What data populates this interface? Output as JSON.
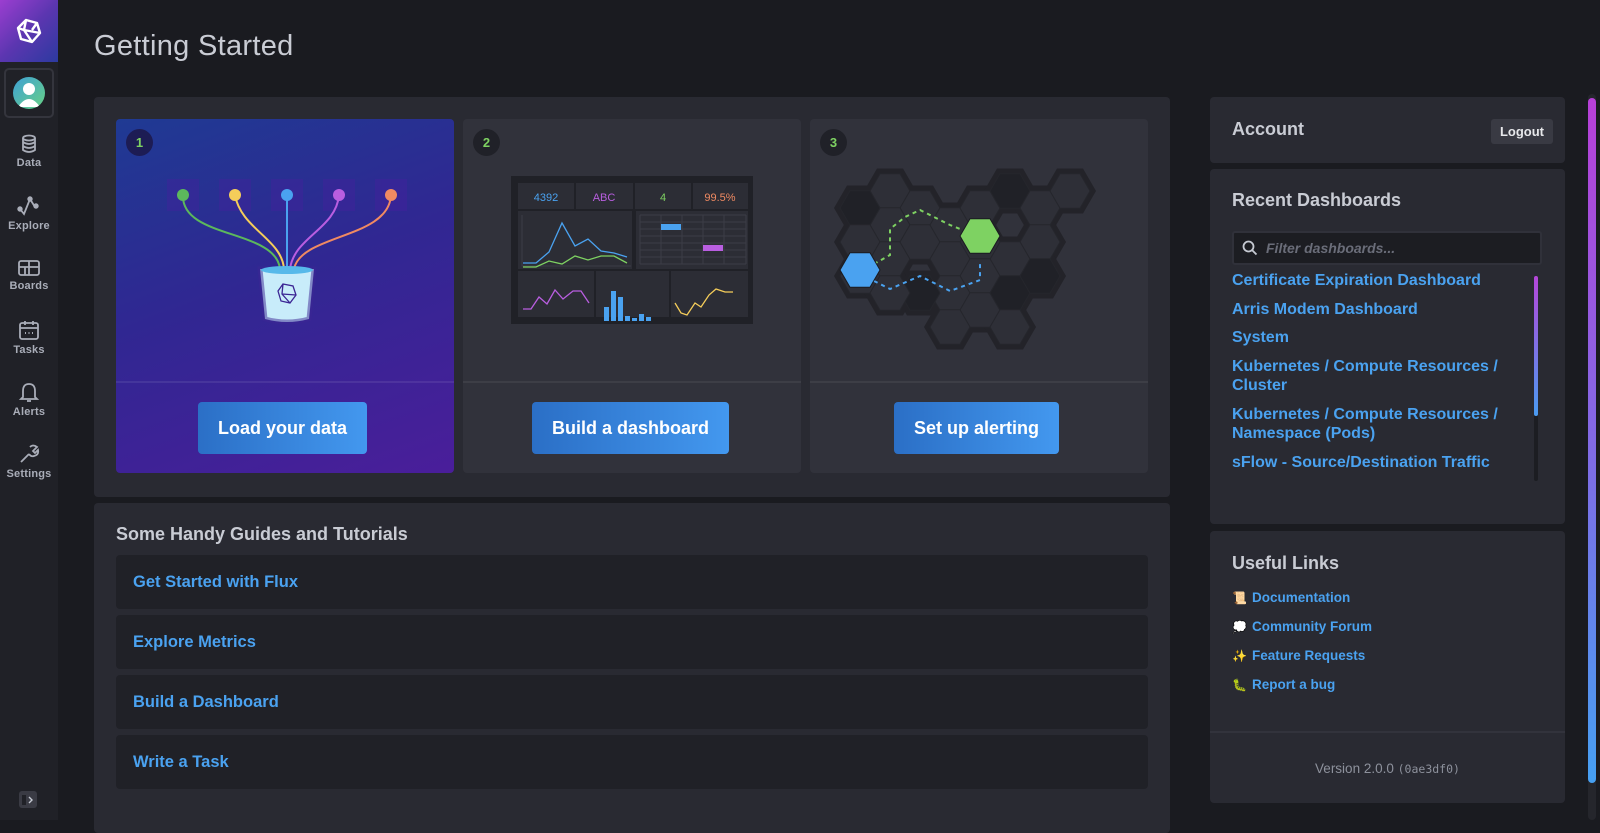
{
  "sidebar": {
    "logo": "influxdb-logo-icon",
    "avatar": "user-avatar-icon",
    "items": [
      {
        "label": "Data",
        "icon": "database-icon"
      },
      {
        "label": "Explore",
        "icon": "graph-line-icon"
      },
      {
        "label": "Boards",
        "icon": "dashboard-grid-icon"
      },
      {
        "label": "Tasks",
        "icon": "calendar-icon"
      },
      {
        "label": "Alerts",
        "icon": "bell-icon"
      },
      {
        "label": "Settings",
        "icon": "wrench-icon"
      }
    ],
    "collapse_icon": "expand-sidebar-icon"
  },
  "page": {
    "title": "Getting Started"
  },
  "steps": [
    {
      "number": "1",
      "button": "Load your data",
      "illustration": "data-sources-bucket"
    },
    {
      "number": "2",
      "button": "Build a dashboard",
      "illustration": "dashboard-preview",
      "preview_stats": [
        {
          "value": "4392",
          "color": "#4aa2f0"
        },
        {
          "value": "ABC",
          "color": "#b95ee0"
        },
        {
          "value": "4",
          "color": "#7ed262"
        },
        {
          "value": "99.5%",
          "color": "#f08a62"
        }
      ]
    },
    {
      "number": "3",
      "button": "Set up alerting",
      "illustration": "hexagon-network"
    }
  ],
  "guides": {
    "title": "Some Handy Guides and Tutorials",
    "items": [
      "Get Started with Flux",
      "Explore Metrics",
      "Build a Dashboard",
      "Write a Task"
    ]
  },
  "account": {
    "title": "Account",
    "logout": "Logout"
  },
  "recent_dashboards": {
    "title": "Recent Dashboards",
    "filter_placeholder": "Filter dashboards...",
    "filter_value": "",
    "search_icon": "search-icon",
    "items": [
      "Certificate Expiration Dashboard",
      "Arris Modem Dashboard",
      "System",
      "Kubernetes / Compute Resources / Cluster",
      "Kubernetes / Compute Resources / Namespace (Pods)",
      "sFlow - Source/Destination Traffic"
    ]
  },
  "useful_links": {
    "title": "Useful Links",
    "items": [
      {
        "emoji": "📜",
        "label": "Documentation"
      },
      {
        "emoji": "💭",
        "label": "Community Forum"
      },
      {
        "emoji": "✨",
        "label": "Feature Requests"
      },
      {
        "emoji": "🐛",
        "label": "Report a bug"
      }
    ]
  },
  "version": {
    "label": "Version 2.0.0",
    "commit": "(0ae3df0)"
  },
  "colors": {
    "accent_blue": "#4aa2f0",
    "green": "#7ed262",
    "purple": "#b95ee0",
    "yellow": "#f5cd5a",
    "orange": "#f08a62"
  }
}
